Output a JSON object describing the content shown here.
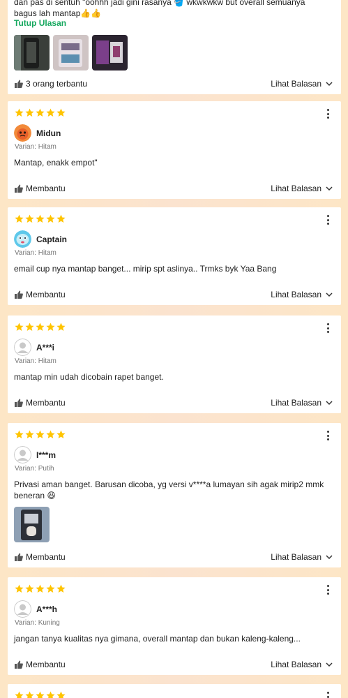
{
  "reviews": [
    {
      "comment": "dan pas di sentuh \"oohhh jadi gini rasanya 🪣 wkwkwkw but overall semuanya bagus lah mantap👍👍",
      "collapse_label": "Tutup Ulasan",
      "helpful_label": "3 orang terbantu",
      "replies_label": "Lihat Balasan"
    },
    {
      "username": "Midun",
      "variant": "Varian: Hitam",
      "comment": "Mantap, enakk empot\"",
      "helpful_label": "Membantu",
      "replies_label": "Lihat Balasan"
    },
    {
      "username": "Captain",
      "variant": "Varian: Hitam",
      "comment": "email cup nya mantap banget... mirip spt aslinya.. Trmks byk Yaa Bang",
      "helpful_label": "Membantu",
      "replies_label": "Lihat Balasan"
    },
    {
      "username": "A***i",
      "variant": "Varian: Hitam",
      "comment": "mantap min udah dicobain rapet banget.",
      "helpful_label": "Membantu",
      "replies_label": "Lihat Balasan"
    },
    {
      "username": "I***m",
      "variant": "Varian: Putih",
      "comment": "Privasi aman banget. Barusan dicoba, yg versi v****a lumayan sih agak mirip2 mmk beneran 😆",
      "helpful_label": "Membantu",
      "replies_label": "Lihat Balasan"
    },
    {
      "username": "A***h",
      "variant": "Varian: Kuning",
      "comment": "jangan tanya kualitas nya gimana, overall mantap dan bukan kaleng-kaleng...",
      "helpful_label": "Membantu",
      "replies_label": "Lihat Balasan"
    }
  ],
  "rating": 5,
  "colors": {
    "star": "#ffc400",
    "link_green": "#17a85f",
    "background": "#fde6c6"
  },
  "icons": {
    "star": "star-icon",
    "thumb": "thumbs-up-icon",
    "chevron": "chevron-down-icon",
    "kebab": "more-vertical-icon"
  }
}
